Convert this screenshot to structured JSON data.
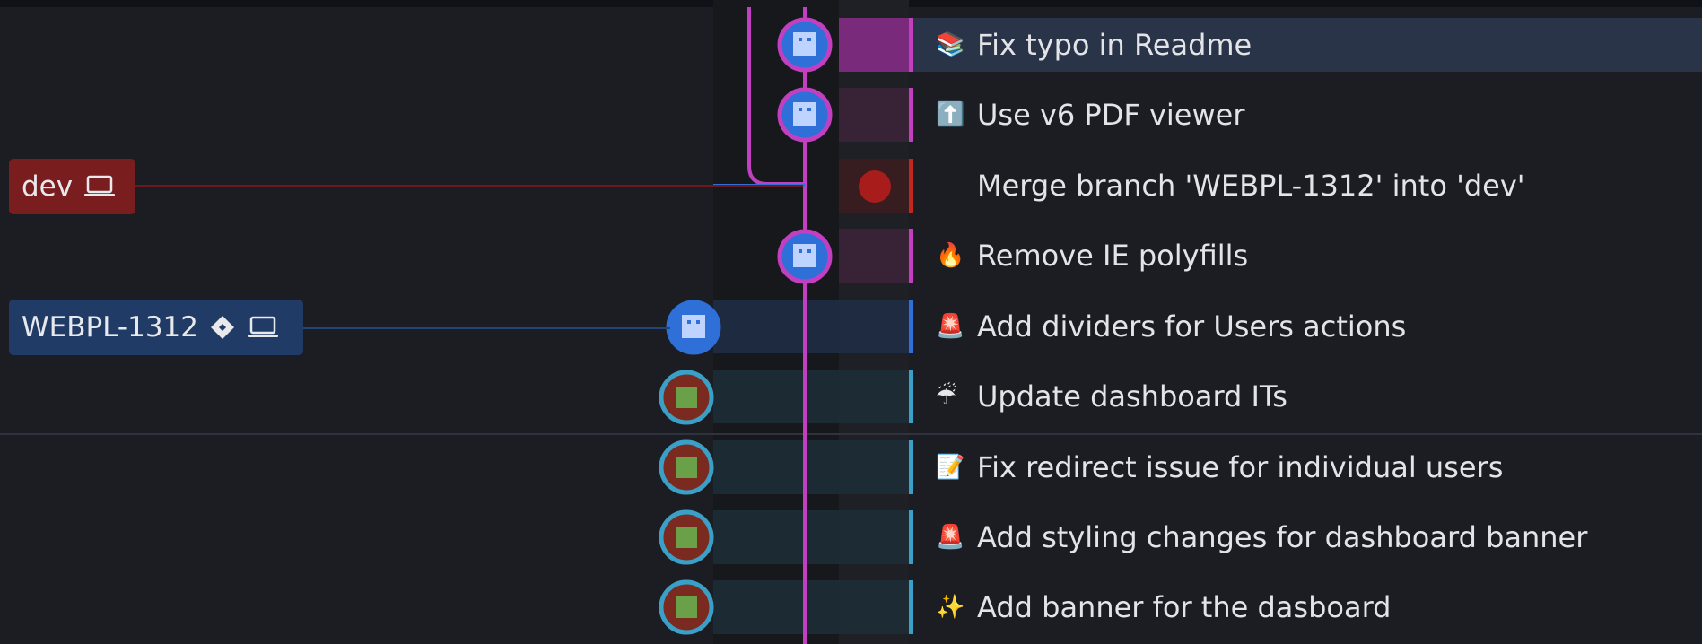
{
  "branches": [
    {
      "name": "dev",
      "color": "#7a1d1f",
      "line_color": "#8a1d22",
      "icons": [
        "laptop-icon"
      ]
    },
    {
      "name": "WEBPL-1312",
      "color": "#1f3b66",
      "line_color": "#2a4f8a",
      "icons": [
        "diamond-icon",
        "laptop-icon"
      ]
    }
  ],
  "commits": [
    {
      "emoji": "📚",
      "message": "Fix typo in Readme",
      "bar_color": "#c13fc0",
      "selected": true
    },
    {
      "emoji": "⬆️",
      "message": "Use v6 PDF viewer",
      "bar_color": "#c13fc0",
      "selected": false
    },
    {
      "emoji": "",
      "message": "Merge branch 'WEBPL-1312' into 'dev'",
      "bar_color": "#c0281f",
      "selected": false
    },
    {
      "emoji": "🔥",
      "message": "Remove IE polyfills",
      "bar_color": "#c13fc0",
      "selected": false
    },
    {
      "emoji": "🚨",
      "message": "Add dividers for Users actions",
      "bar_color": "#2e6fd8",
      "selected": false
    },
    {
      "emoji": "☔",
      "message": "Update dashboard ITs",
      "bar_color": "#3aa0c8",
      "selected": false
    },
    {
      "emoji": "📝",
      "message": "Fix redirect issue for individual users",
      "bar_color": "#3aa0c8",
      "selected": false
    },
    {
      "emoji": "🚨",
      "message": "Add styling changes for dashboard banner",
      "bar_color": "#3aa0c8",
      "selected": false
    },
    {
      "emoji": "✨",
      "message": "Add banner for the dasboard",
      "bar_color": "#3aa0c8",
      "selected": false
    }
  ],
  "colors": {
    "background": "#1c1d22",
    "selected_row": "#2a3448",
    "graph_column": "#16171b",
    "purple_line": "#c13fc0",
    "blue_line": "#2e6fd8",
    "merge_dot": "#a81c1c"
  }
}
